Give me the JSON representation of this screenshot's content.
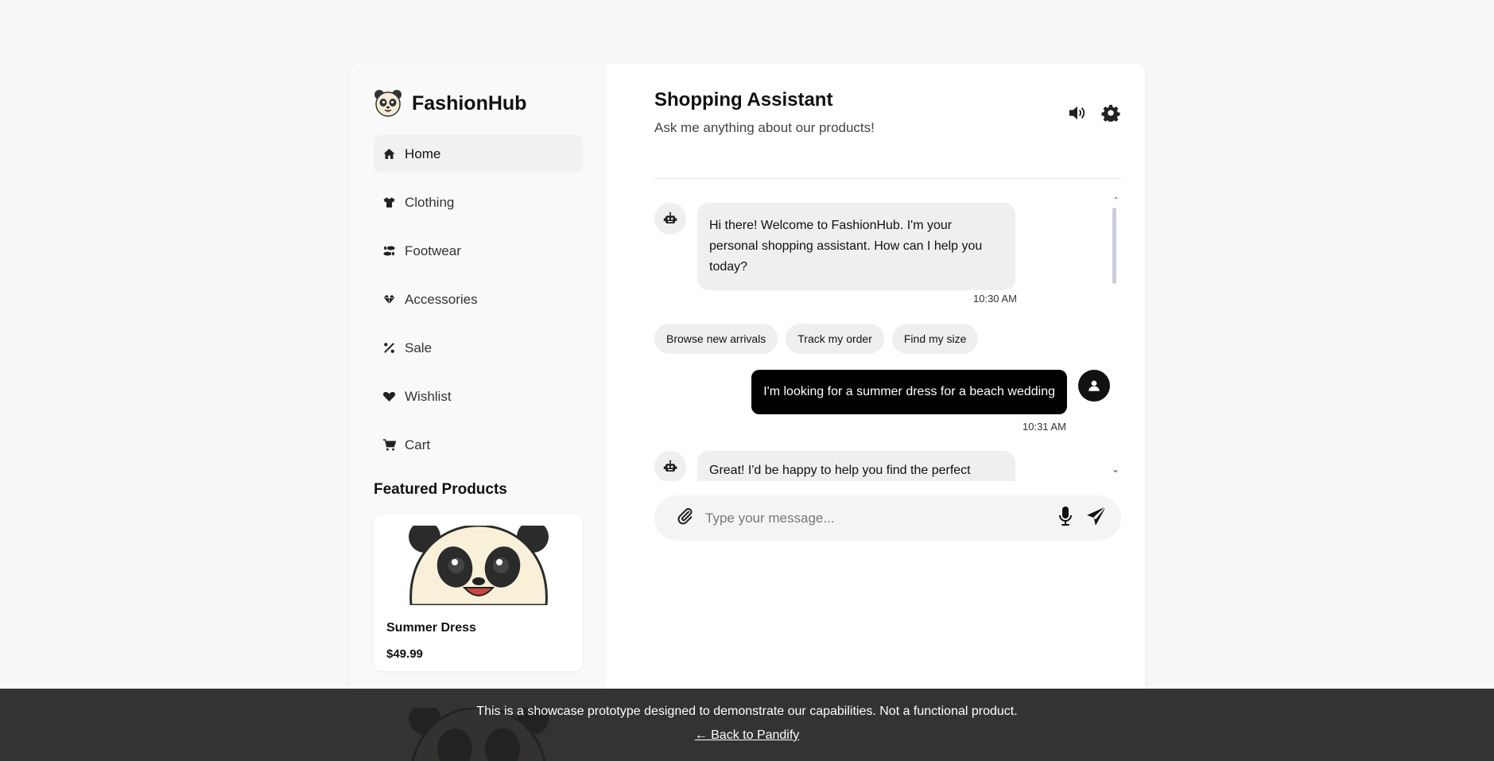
{
  "brand": {
    "name": "FashionHub",
    "logo_icon": "panda-logo-icon"
  },
  "sidebar": {
    "items": [
      {
        "label": "Home",
        "icon": "home-icon",
        "active": true
      },
      {
        "label": "Clothing",
        "icon": "tshirt-icon",
        "active": false
      },
      {
        "label": "Footwear",
        "icon": "shoe-prints-icon",
        "active": false
      },
      {
        "label": "Accessories",
        "icon": "gem-icon",
        "active": false
      },
      {
        "label": "Sale",
        "icon": "percent-icon",
        "active": false
      },
      {
        "label": "Wishlist",
        "icon": "heart-icon",
        "active": false
      },
      {
        "label": "Cart",
        "icon": "cart-icon",
        "active": false
      }
    ],
    "featured_title": "Featured Products",
    "products": [
      {
        "name": "Summer Dress",
        "price": "$49.99"
      }
    ]
  },
  "chat": {
    "title": "Shopping Assistant",
    "subtitle": "Ask me anything about our products!",
    "messages": [
      {
        "from": "bot",
        "text": "Hi there! Welcome to FashionHub. I'm your personal shopping assistant. How can I help you today?",
        "time": "10:30 AM"
      },
      {
        "from": "user",
        "text": "I'm looking for a summer dress for a beach wedding",
        "time": "10:31 AM"
      },
      {
        "from": "bot",
        "text": "Great! I'd be happy to help you find the perfect"
      }
    ],
    "quick_replies": [
      "Browse new arrivals",
      "Track my order",
      "Find my size"
    ],
    "input_placeholder": "Type your message..."
  },
  "banner": {
    "text": "This is a showcase prototype designed to demonstrate our capabilities. Not a functional product.",
    "link": "← Back to Pandify"
  },
  "colors": {
    "accent": "#000000",
    "bubble_bot": "#efefef",
    "banner_bg": "#222222"
  }
}
